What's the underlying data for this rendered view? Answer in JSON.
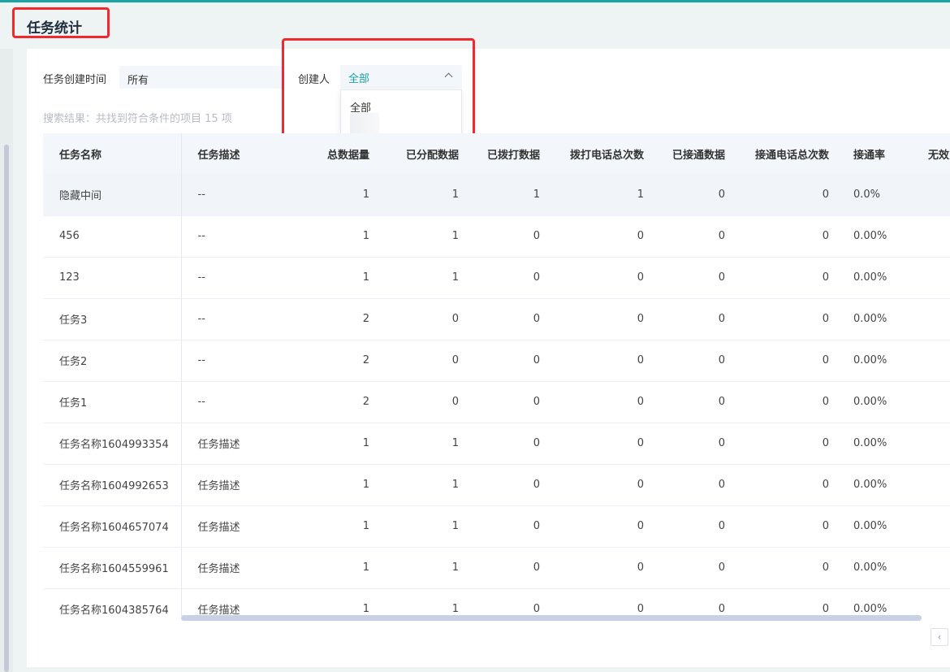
{
  "page": {
    "title": "任务统计"
  },
  "filters": {
    "time_label": "任务创建时间",
    "time_value": "所有",
    "creator_label": "创建人",
    "creator_value": "全部",
    "creator_options": [
      "全部"
    ]
  },
  "result_text": "搜索结果：共找到符合条件的项目 15 项",
  "table": {
    "headers": [
      "任务名称",
      "任务描述",
      "总数据量",
      "已分配数据",
      "已拨打数据",
      "拨打电话总次数",
      "已接通数据",
      "接通电话总次数",
      "接通率",
      "无效"
    ],
    "rows": [
      [
        "隐藏中间",
        "--",
        "1",
        "1",
        "1",
        "1",
        "0",
        "0",
        "0.0%"
      ],
      [
        "456",
        "--",
        "1",
        "1",
        "0",
        "0",
        "0",
        "0",
        "0.00%"
      ],
      [
        "123",
        "--",
        "1",
        "1",
        "0",
        "0",
        "0",
        "0",
        "0.00%"
      ],
      [
        "任务3",
        "--",
        "2",
        "0",
        "0",
        "0",
        "0",
        "0",
        "0.00%"
      ],
      [
        "任务2",
        "--",
        "2",
        "0",
        "0",
        "0",
        "0",
        "0",
        "0.00%"
      ],
      [
        "任务1",
        "--",
        "2",
        "0",
        "0",
        "0",
        "0",
        "0",
        "0.00%"
      ],
      [
        "任务名称1604993354",
        "任务描述",
        "1",
        "1",
        "0",
        "0",
        "0",
        "0",
        "0.00%"
      ],
      [
        "任务名称1604992653",
        "任务描述",
        "1",
        "1",
        "0",
        "0",
        "0",
        "0",
        "0.00%"
      ],
      [
        "任务名称1604657074",
        "任务描述",
        "1",
        "1",
        "0",
        "0",
        "0",
        "0",
        "0.00%"
      ],
      [
        "任务名称1604559961",
        "任务描述",
        "1",
        "1",
        "0",
        "0",
        "0",
        "0",
        "0.00%"
      ],
      [
        "任务名称1604385764",
        "任务描述",
        "1",
        "1",
        "0",
        "0",
        "0",
        "0",
        "0.00%"
      ]
    ]
  },
  "pagination": {
    "prev_icon": "chevron-left-icon",
    "prev_glyph": "‹"
  },
  "colors": {
    "accent": "#1aa3a3",
    "highlight": "#f0292f"
  }
}
